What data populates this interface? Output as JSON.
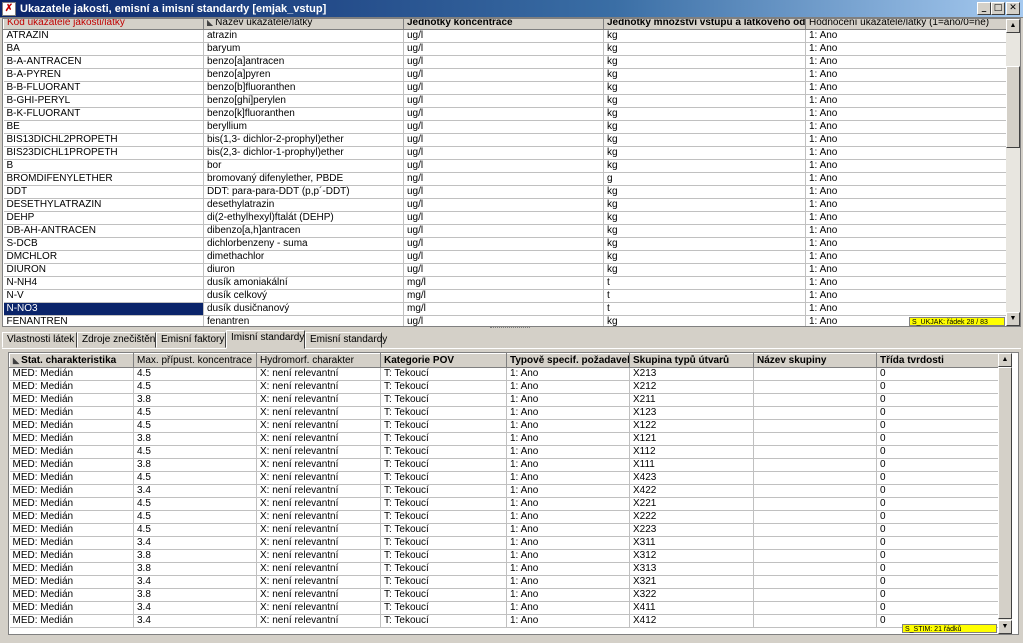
{
  "window": {
    "title": "Ukazatele jakosti, emisní a imisní standardy [emjak_vstup]",
    "app_icon_glyph": "✗",
    "minimize_glyph": "_",
    "maximize_glyph": "□",
    "close_glyph": "✕"
  },
  "top_grid": {
    "columns": [
      "Kód ukazatele jakosti/látky",
      "Název ukazatele/látky",
      "Jednotky koncentrace",
      "Jednotky množství vstupu a látkového odn",
      "Hodnocení ukazatele/látky (1=ano/0=ne)"
    ],
    "rows": [
      [
        "ATRAZIN",
        "atrazin",
        "ug/l",
        "kg",
        "1: Ano"
      ],
      [
        "BA",
        "baryum",
        "ug/l",
        "kg",
        "1: Ano"
      ],
      [
        "B-A-ANTRACEN",
        "benzo[a]antracen",
        "ug/l",
        "kg",
        "1: Ano"
      ],
      [
        "B-A-PYREN",
        "benzo[a]pyren",
        "ug/l",
        "kg",
        "1: Ano"
      ],
      [
        "B-B-FLUORANT",
        "benzo[b]fluoranthen",
        "ug/l",
        "kg",
        "1: Ano"
      ],
      [
        "B-GHI-PERYL",
        "benzo[ghi]perylen",
        "ug/l",
        "kg",
        "1: Ano"
      ],
      [
        "B-K-FLUORANT",
        "benzo[k]fluoranthen",
        "ug/l",
        "kg",
        "1: Ano"
      ],
      [
        "BE",
        "beryllium",
        "ug/l",
        "kg",
        "1: Ano"
      ],
      [
        "BIS13DICHL2PROPETH",
        "bis(1,3- dichlor-2-prophyl)ether",
        "ug/l",
        "kg",
        "1: Ano"
      ],
      [
        "BIS23DICHL1PROPETH",
        "bis(2,3- dichlor-1-prophyl)ether",
        "ug/l",
        "kg",
        "1: Ano"
      ],
      [
        "B",
        "bor",
        "ug/l",
        "kg",
        "1: Ano"
      ],
      [
        "BROMDIFENYLETHER",
        "bromovaný difenylether, PBDE",
        "ng/l",
        "g",
        "1: Ano"
      ],
      [
        "DDT",
        "DDT: para-para-DDT (p,p´-DDT)",
        "ug/l",
        "kg",
        "1: Ano"
      ],
      [
        "DESETHYLATRAZIN",
        "desethylatrazin",
        "ug/l",
        "kg",
        "1: Ano"
      ],
      [
        "DEHP",
        "di(2-ethylhexyl)ftalát (DEHP)",
        "ug/l",
        "kg",
        "1: Ano"
      ],
      [
        "DB-AH-ANTRACEN",
        "dibenzo[a,h]antracen",
        "ug/l",
        "kg",
        "1: Ano"
      ],
      [
        "S-DCB",
        "dichlorbenzeny - suma",
        "ug/l",
        "kg",
        "1: Ano"
      ],
      [
        "DMCHLOR",
        "dimethachlor",
        "ug/l",
        "kg",
        "1: Ano"
      ],
      [
        "DIURON",
        "diuron",
        "ug/l",
        "kg",
        "1: Ano"
      ],
      [
        "N-NH4",
        "dusík amoniakální",
        "mg/l",
        "t",
        "1: Ano"
      ],
      [
        "N-V",
        "dusík celkový",
        "mg/l",
        "t",
        "1: Ano"
      ],
      [
        "N-NO3",
        "dusík dusičnanový",
        "mg/l",
        "t",
        "1: Ano"
      ],
      [
        "FENANTREN",
        "fenantren",
        "ug/l",
        "kg",
        "1: Ano"
      ]
    ],
    "selected_row": 21,
    "status": "S_UKJAK: řádek 28 / 83"
  },
  "tabs": [
    "Vlastnosti látek",
    "Zdroje znečištění",
    "Emisní faktory",
    "Imisní standardy",
    "Emisní standardy"
  ],
  "active_tab": 3,
  "bottom_grid": {
    "columns": [
      "Stat. charakteristika",
      "Max. přípust. koncentrace",
      "Hydromorf. charakter",
      "Kategorie POV",
      "Typově specif. požadavek",
      "Skupina typů útvarů",
      "Název skupiny",
      "Třída tvrdosti"
    ],
    "rows": [
      [
        "MED: Medián",
        "4.5",
        "X: není relevantní",
        "T: Tekoucí",
        "1: Ano",
        "X213",
        "",
        "0"
      ],
      [
        "MED: Medián",
        "4.5",
        "X: není relevantní",
        "T: Tekoucí",
        "1: Ano",
        "X212",
        "",
        "0"
      ],
      [
        "MED: Medián",
        "3.8",
        "X: není relevantní",
        "T: Tekoucí",
        "1: Ano",
        "X211",
        "",
        "0"
      ],
      [
        "MED: Medián",
        "4.5",
        "X: není relevantní",
        "T: Tekoucí",
        "1: Ano",
        "X123",
        "",
        "0"
      ],
      [
        "MED: Medián",
        "4.5",
        "X: není relevantní",
        "T: Tekoucí",
        "1: Ano",
        "X122",
        "",
        "0"
      ],
      [
        "MED: Medián",
        "3.8",
        "X: není relevantní",
        "T: Tekoucí",
        "1: Ano",
        "X121",
        "",
        "0"
      ],
      [
        "MED: Medián",
        "4.5",
        "X: není relevantní",
        "T: Tekoucí",
        "1: Ano",
        "X112",
        "",
        "0"
      ],
      [
        "MED: Medián",
        "3.8",
        "X: není relevantní",
        "T: Tekoucí",
        "1: Ano",
        "X111",
        "",
        "0"
      ],
      [
        "MED: Medián",
        "4.5",
        "X: není relevantní",
        "T: Tekoucí",
        "1: Ano",
        "X423",
        "",
        "0"
      ],
      [
        "MED: Medián",
        "3.4",
        "X: není relevantní",
        "T: Tekoucí",
        "1: Ano",
        "X422",
        "",
        "0"
      ],
      [
        "MED: Medián",
        "4.5",
        "X: není relevantní",
        "T: Tekoucí",
        "1: Ano",
        "X221",
        "",
        "0"
      ],
      [
        "MED: Medián",
        "4.5",
        "X: není relevantní",
        "T: Tekoucí",
        "1: Ano",
        "X222",
        "",
        "0"
      ],
      [
        "MED: Medián",
        "4.5",
        "X: není relevantní",
        "T: Tekoucí",
        "1: Ano",
        "X223",
        "",
        "0"
      ],
      [
        "MED: Medián",
        "3.4",
        "X: není relevantní",
        "T: Tekoucí",
        "1: Ano",
        "X311",
        "",
        "0"
      ],
      [
        "MED: Medián",
        "3.8",
        "X: není relevantní",
        "T: Tekoucí",
        "1: Ano",
        "X312",
        "",
        "0"
      ],
      [
        "MED: Medián",
        "3.8",
        "X: není relevantní",
        "T: Tekoucí",
        "1: Ano",
        "X313",
        "",
        "0"
      ],
      [
        "MED: Medián",
        "3.4",
        "X: není relevantní",
        "T: Tekoucí",
        "1: Ano",
        "X321",
        "",
        "0"
      ],
      [
        "MED: Medián",
        "3.8",
        "X: není relevantní",
        "T: Tekoucí",
        "1: Ano",
        "X322",
        "",
        "0"
      ],
      [
        "MED: Medián",
        "3.4",
        "X: není relevantní",
        "T: Tekoucí",
        "1: Ano",
        "X411",
        "",
        "0"
      ],
      [
        "MED: Medián",
        "3.4",
        "X: není relevantní",
        "T: Tekoucí",
        "1: Ano",
        "X412",
        "",
        "0"
      ]
    ],
    "status": "S_STIM: 21 řádků"
  },
  "scrollbar_glyphs": {
    "up": "▲",
    "down": "▼"
  },
  "colors": {
    "selection": "#0a246a",
    "status_bg": "#ffff00",
    "key_header": "#c00000"
  }
}
